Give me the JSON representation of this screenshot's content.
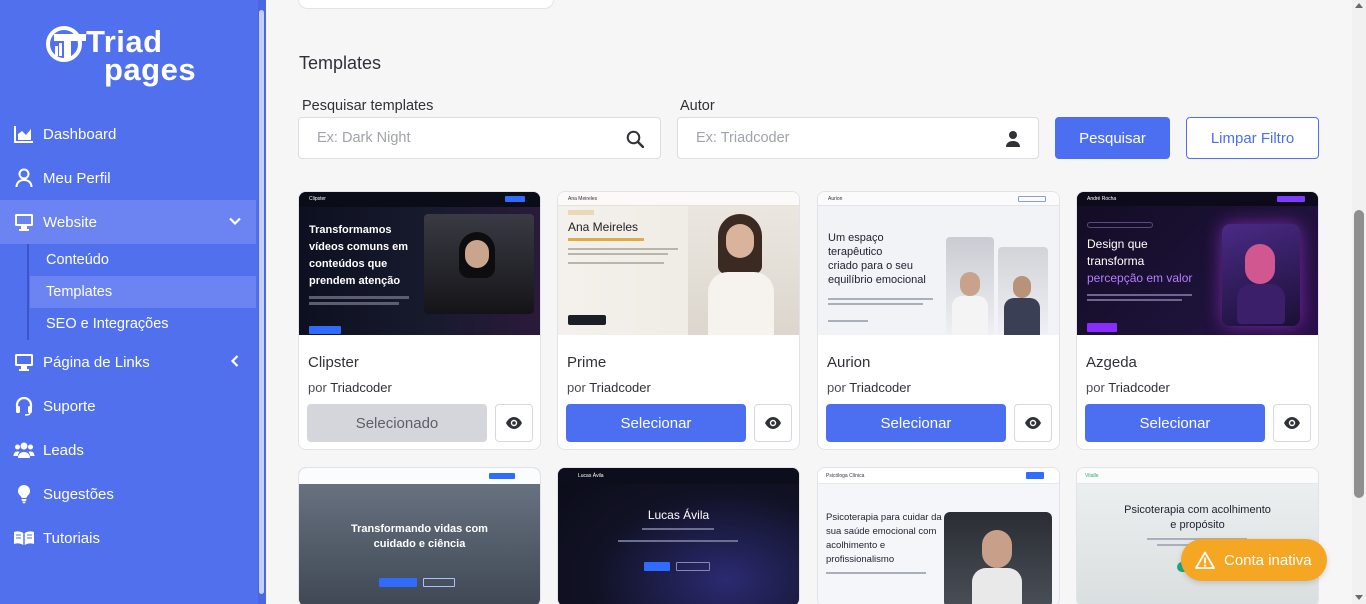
{
  "brand": {
    "line1": "Triad",
    "line2": "pages"
  },
  "sidebar": {
    "items": [
      {
        "label": "Dashboard",
        "icon": "chart-area-icon"
      },
      {
        "label": "Meu Perfil",
        "icon": "user-icon"
      },
      {
        "label": "Website",
        "icon": "desktop-icon"
      },
      {
        "label": "Página de Links",
        "icon": "desktop-icon"
      },
      {
        "label": "Suporte",
        "icon": "headset-icon"
      },
      {
        "label": "Leads",
        "icon": "users-icon"
      },
      {
        "label": "Sugestões",
        "icon": "lightbulb-icon"
      },
      {
        "label": "Tutoriais",
        "icon": "book-open-icon"
      }
    ],
    "subitems": [
      {
        "label": "Conteúdo"
      },
      {
        "label": "Templates"
      },
      {
        "label": "SEO e Integrações"
      }
    ]
  },
  "main": {
    "section_title": "Templates",
    "filters": {
      "search_label": "Pesquisar templates",
      "search_placeholder": "Ex: Dark Night",
      "author_label": "Autor",
      "author_placeholder": "Ex: Triadcoder",
      "search_button": "Pesquisar",
      "clear_button": "Limpar Filtro"
    },
    "author_prefix": "por",
    "cards": [
      {
        "name": "Clipster",
        "author": "Triadcoder",
        "button": "Selecionado",
        "selected": true,
        "preview": {
          "brand": "Clipster",
          "headline1": "Transformamos",
          "headline2": "vídeos comuns em",
          "headline3": "conteúdos que",
          "headline4": "prendem atenção"
        }
      },
      {
        "name": "Prime",
        "author": "Triadcoder",
        "button": "Selecionar",
        "selected": false,
        "preview": {
          "brand": "Ana Meireles",
          "headline1": "Ana Meireles"
        }
      },
      {
        "name": "Aurion",
        "author": "Triadcoder",
        "button": "Selecionar",
        "selected": false,
        "preview": {
          "brand": "Aurion",
          "headline1": "Um espaço",
          "headline2": "terapêutico",
          "headline3": "criado para o seu",
          "headline4": "equilíbrio emocional"
        }
      },
      {
        "name": "Azgeda",
        "author": "Triadcoder",
        "button": "Selecionar",
        "selected": false,
        "preview": {
          "brand": "André Rocha",
          "headline1": "Design que",
          "headline2": "transforma",
          "headline3": "percepção em valor"
        }
      }
    ],
    "cards_row2": [
      {
        "preview": {
          "headline1": "Transformando vidas com",
          "headline2": "cuidado e ciência"
        }
      },
      {
        "preview": {
          "brand": "Lucas Ávila",
          "headline1": "Lucas Ávila"
        }
      },
      {
        "preview": {
          "brand": "Psicóloga Clínica",
          "headline1": "Psicoterapia para cuidar da",
          "headline2": "sua saúde emocional com",
          "headline3": "acolhimento e",
          "headline4": "profissionalismo"
        }
      },
      {
        "preview": {
          "brand": "Vitalle",
          "headline1": "Psicoterapia com acolhimento",
          "headline2": "e propósito"
        }
      }
    ]
  },
  "toast": {
    "label": "Conta inativa",
    "color": "#f5a623"
  },
  "colors": {
    "sidebar": "#5170ee",
    "accent": "#4c6ef0",
    "active_item": "#6b84f1"
  }
}
